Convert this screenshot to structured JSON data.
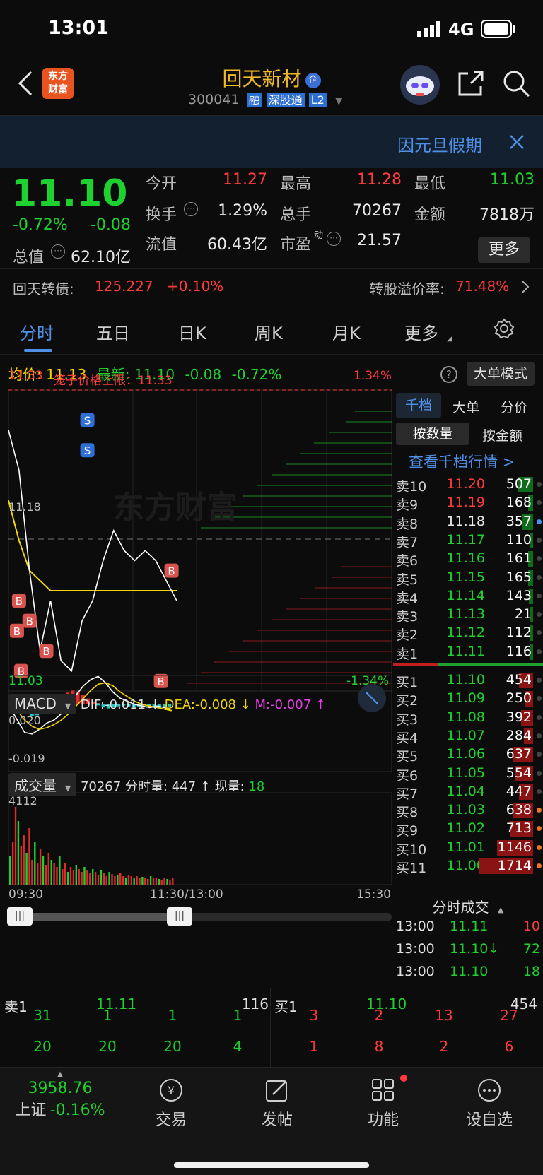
{
  "status_bar": {
    "time": "13:01",
    "network": "4G"
  },
  "header": {
    "stock_name": "回天新材",
    "badge": "企",
    "code": "300041",
    "tags": [
      "融",
      "深股通",
      "L2"
    ],
    "logo_line1": "东方",
    "logo_line2": "财富"
  },
  "banner": {
    "text": "因元旦假期"
  },
  "quote": {
    "price": "11.10",
    "change_pct": "-0.72%",
    "change": "-0.08",
    "rows": [
      [
        {
          "label": "今开",
          "value": "11.27",
          "color": "red"
        },
        {
          "label": "最高",
          "value": "11.28",
          "color": "red"
        },
        {
          "label": "最低",
          "value": "11.03",
          "color": "green"
        }
      ],
      [
        {
          "label": "换手",
          "value": "1.29%",
          "color": "white"
        },
        {
          "label": "总手",
          "value": "70267",
          "color": "white"
        },
        {
          "label": "金额",
          "value": "7818万",
          "color": "white"
        }
      ],
      [
        {
          "label": "总值",
          "value": "62.10亿",
          "color": "white"
        },
        {
          "label": "流值",
          "value": "60.43亿",
          "color": "white"
        },
        {
          "label": "市盈",
          "sup": "动",
          "value": "21.57",
          "color": "white"
        }
      ]
    ],
    "more_button": "更多"
  },
  "convertible": {
    "label": "回天转债:",
    "price": "125.227",
    "change": "+0.10%",
    "premium_label": "转股溢价率:",
    "premium": "71.48%"
  },
  "tabs": [
    "分时",
    "五日",
    "日K",
    "周K",
    "月K",
    "更多"
  ],
  "active_tab": "分时",
  "info_line": {
    "avg_label": "均价:",
    "avg": "11.13",
    "latest_label": "最新:",
    "latest": "11.10",
    "change": "-0.08",
    "change_pct": "-0.72%",
    "big_order_button": "大单模式"
  },
  "chart_labels": {
    "top_price": "11.33",
    "limit_text": "笼子价格上限：11.33",
    "top_pct": "1.34%",
    "mid_price": "11.18",
    "bottom_price": "11.03",
    "bottom_pct": "-1.34%",
    "watermark": "东方财富"
  },
  "chart_data": {
    "type": "line",
    "title": "",
    "xlabel": "",
    "ylabel": "",
    "ylim": [
      11.03,
      11.33
    ],
    "x": [
      "09:30",
      "11:30/13:00",
      "15:30"
    ],
    "series": [
      {
        "values": [
          11.29,
          11.25,
          11.15,
          11.07,
          11.12,
          11.06,
          11.05,
          11.1,
          11.12,
          11.16,
          11.19,
          11.17,
          11.16,
          11.17,
          11.16,
          11.14,
          11.12
        ]
      },
      {
        "values": [
          11.22,
          11.18,
          11.15,
          11.14,
          11.13,
          11.13,
          11.13,
          11.13,
          11.13,
          11.13,
          11.13,
          11.13,
          11.13,
          11.13,
          11.13,
          11.13,
          11.13
        ]
      }
    ]
  },
  "macd": {
    "label": "MACD",
    "dif_label": "DIF:",
    "dif": "-0.011",
    "dea_label": "DEA:",
    "dea": "-0.008",
    "m_label": "M:",
    "m": "-0.007",
    "top": "0.020",
    "bottom": "-0.019"
  },
  "volume": {
    "label": "成交量",
    "summary": "70267 分时量: 447",
    "now_label": "现量:",
    "now": "18",
    "top": "4112"
  },
  "time_axis": [
    "09:30",
    "11:30/13:00",
    "15:30"
  ],
  "orderbook": {
    "tabs": [
      "千档",
      "大单",
      "分价"
    ],
    "subtabs": [
      "按数量",
      "按金额"
    ],
    "link": "查看千档行情 >",
    "asks": [
      {
        "label": "卖10",
        "price": "11.20",
        "vol": "507",
        "pc": "red"
      },
      {
        "label": "卖9",
        "price": "11.19",
        "vol": "168",
        "pc": "red"
      },
      {
        "label": "卖8",
        "price": "11.18",
        "vol": "357",
        "pc": "white"
      },
      {
        "label": "卖7",
        "price": "11.17",
        "vol": "110",
        "pc": "green"
      },
      {
        "label": "卖6",
        "price": "11.16",
        "vol": "161",
        "pc": "green"
      },
      {
        "label": "卖5",
        "price": "11.15",
        "vol": "165",
        "pc": "green"
      },
      {
        "label": "卖4",
        "price": "11.14",
        "vol": "143",
        "pc": "green"
      },
      {
        "label": "卖3",
        "price": "11.13",
        "vol": "21",
        "pc": "green"
      },
      {
        "label": "卖2",
        "price": "11.12",
        "vol": "112",
        "pc": "green"
      },
      {
        "label": "卖1",
        "price": "11.11",
        "vol": "116",
        "pc": "green"
      }
    ],
    "bids": [
      {
        "label": "买1",
        "price": "11.10",
        "vol": "454"
      },
      {
        "label": "买2",
        "price": "11.09",
        "vol": "250"
      },
      {
        "label": "买3",
        "price": "11.08",
        "vol": "392"
      },
      {
        "label": "买4",
        "price": "11.07",
        "vol": "284"
      },
      {
        "label": "买5",
        "price": "11.06",
        "vol": "637"
      },
      {
        "label": "买6",
        "price": "11.05",
        "vol": "554"
      },
      {
        "label": "买7",
        "price": "11.04",
        "vol": "447"
      },
      {
        "label": "买8",
        "price": "11.03",
        "vol": "638"
      },
      {
        "label": "买9",
        "price": "11.02",
        "vol": "713"
      },
      {
        "label": "买10",
        "price": "11.01",
        "vol": "1146"
      },
      {
        "label": "买11",
        "price": "11.00",
        "vol": "1714"
      }
    ],
    "trades_title": "分时成交",
    "trades": [
      {
        "time": "13:00",
        "price": "11.11",
        "vol": "10",
        "vc": "red"
      },
      {
        "time": "13:00",
        "price": "11.10↓",
        "vol": "72",
        "vc": "green"
      },
      {
        "time": "13:00",
        "price": "11.10",
        "vol": "18",
        "vc": "green"
      }
    ]
  },
  "queue": {
    "sell_label": "卖1",
    "sell_price": "11.11",
    "sell_vol": "116",
    "buy_label": "买1",
    "buy_price": "11.10",
    "buy_vol": "454",
    "sell_row1": [
      "31",
      "1",
      "1",
      "1"
    ],
    "sell_row2": [
      "20",
      "20",
      "20",
      "4"
    ],
    "buy_row1": [
      "3",
      "2",
      "13",
      "27"
    ],
    "buy_row2": [
      "1",
      "8",
      "2",
      "6"
    ]
  },
  "bottom_nav": {
    "index_value": "3958.76",
    "index_name": "上证",
    "index_change": "-0.16%",
    "items": [
      "交易",
      "发帖",
      "功能",
      "设自选"
    ]
  }
}
